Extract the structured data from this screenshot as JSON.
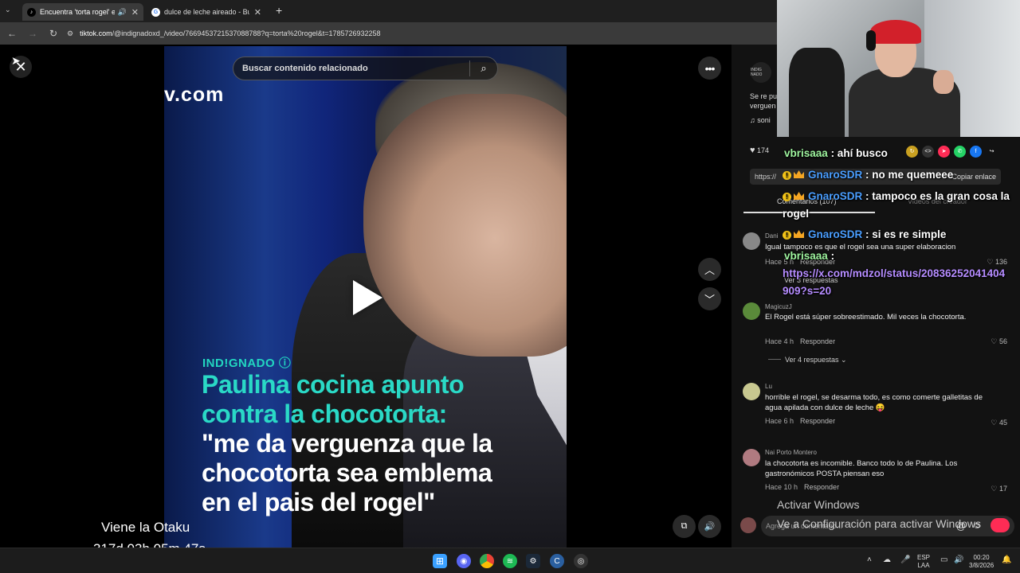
{
  "browser": {
    "tabs": [
      {
        "label": "Encuentra 'torta rogel' en TikTok",
        "icon": "tiktok-icon",
        "active": true
      },
      {
        "label": "dulce de leche aireado - Buscar con Google",
        "icon": "google-icon",
        "active": false
      }
    ],
    "new_tab": "+",
    "url_host": "tiktok.com",
    "url_rest": "/@indignadoxd_/video/7669453721537088788?q=torta%20rogel&t=1785726932258"
  },
  "video": {
    "search_placeholder": "Buscar contenido relacionado",
    "watermark": "v.com",
    "brand": "IND!GNADO ⓘ",
    "headline_line1": "Paulina cocina apunto",
    "headline_line2": "contra la chocotorta:",
    "quote_line1": "\"me da verguenza que la",
    "quote_line2": "chocotorta sea emblema",
    "quote_line3": "en el pais del rogel\""
  },
  "stream_overlay": {
    "title": "Viene la Otaku",
    "timer": "317d 03h 05m 47s"
  },
  "panel": {
    "logo_text": "INDIG NADO",
    "desc_line1": "Se re pu",
    "desc_line2": "verguen",
    "sound": "♫  soni",
    "likes": "174",
    "link": "https://",
    "copy_link": "Copiar enlace",
    "tab_comments": "Comentarios (107)",
    "tab_creator": "Videos del creador",
    "add_comment": "Agrega un comentario..."
  },
  "comments": [
    {
      "name": "Dani",
      "text": "Igual tampoco es que el rogel sea una super elaboracion",
      "time": "Hace 5 h",
      "reply": "Responder",
      "likes": "136",
      "more": "Ver 3 respuestas",
      "avatar_color": "#888888"
    },
    {
      "name": "MagicuzJ",
      "text": "El Rogel está súper sobreestimado. Mil veces la chocotorta.",
      "time": "Hace 4 h",
      "reply": "Responder",
      "likes": "56",
      "more": "Ver 4 respuestas ⌄",
      "avatar_color": "#5a8a3a"
    },
    {
      "name": "Lu",
      "text": "horrible el rogel, se desarma todo, es como comerte galletitas de agua apilada con dulce de leche 😝",
      "time": "Hace 6 h",
      "reply": "Responder",
      "likes": "45",
      "avatar_color": "#c8c890"
    },
    {
      "name": "Nai Porto Montero",
      "text": "la chocotorta es incomible. Banco todo lo de Paulina. Los gastronómicos POSTA piensan eso",
      "time": "Hace 10 h",
      "reply": "Responder",
      "likes": "17",
      "avatar_color": "#b07a80"
    }
  ],
  "chat": [
    {
      "user": "vbrisaaa",
      "msg": ": ahí busco",
      "badges": false
    },
    {
      "user": "GnaroSDR",
      "msg": ": no me quemeee",
      "badges": true
    },
    {
      "user": "GnaroSDR",
      "msg": ": tampoco es la gran cosa la",
      "msg2": "rogel",
      "badges": true
    },
    {
      "user": "GnaroSDR",
      "msg": ": si es re simple",
      "badges": true
    },
    {
      "user": "vbrisaaa",
      "msg": ":",
      "link1": "https://x.com/mdzol/status/20836252041404",
      "link2": "909?s=20",
      "badges": false
    }
  ],
  "windows": {
    "activate_title": "Activar Windows",
    "activate_sub": "Ve a Configuración para activar Windows",
    "lang1": "ESP",
    "lang2": "LAA",
    "time": "00:20",
    "date": "3/8/2026"
  },
  "colors": {
    "accent_teal": "#2ad9c6",
    "chat_user_green": "#9ff59f",
    "chat_user_blue": "#4a9eff",
    "chat_link": "#b58cff",
    "tiktok_red": "#fe2c55"
  }
}
